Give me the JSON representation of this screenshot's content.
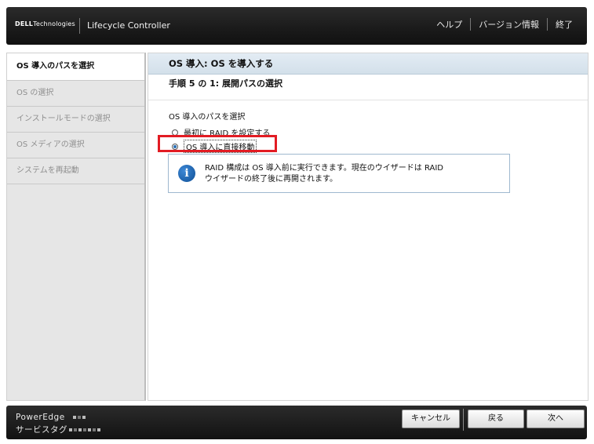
{
  "header": {
    "logo_brand": "DELL",
    "logo_suffix": "Technologies",
    "app_title": "Lifecycle Controller",
    "nav": [
      "ヘルプ",
      "バージョン情報",
      "終了"
    ]
  },
  "sidebar": {
    "items": [
      {
        "label": "OS 導入のパスを選択",
        "active": true
      },
      {
        "label": "OS の選択",
        "active": false
      },
      {
        "label": "インストールモードの選択",
        "active": false
      },
      {
        "label": "OS メディアの選択",
        "active": false
      },
      {
        "label": "システムを再起動",
        "active": false
      }
    ]
  },
  "main": {
    "title": "OS 導入:  OS を導入する",
    "step": "手順 5 の 1:  展開パスの選択",
    "section_label": "OS 導入のパスを選択",
    "options": [
      {
        "label": "最初に RAID を設定する",
        "checked": false
      },
      {
        "label": "OS 導入に直接移動",
        "checked": true
      }
    ],
    "info": {
      "line1": "RAID 構成は OS 導入前に実行できます。現在のウイザードは RAID",
      "line2": "ウイザードの終了後に再開されます。"
    }
  },
  "footer": {
    "model": "PowerEdge",
    "service_tag": "サービスタグ",
    "buttons": {
      "cancel": "キャンセル",
      "back": "戻る",
      "next": "次へ"
    }
  },
  "colors": {
    "highlight": "#e21c23",
    "title_bar": "#d3e0ea",
    "info_icon": "#1f66b3"
  }
}
